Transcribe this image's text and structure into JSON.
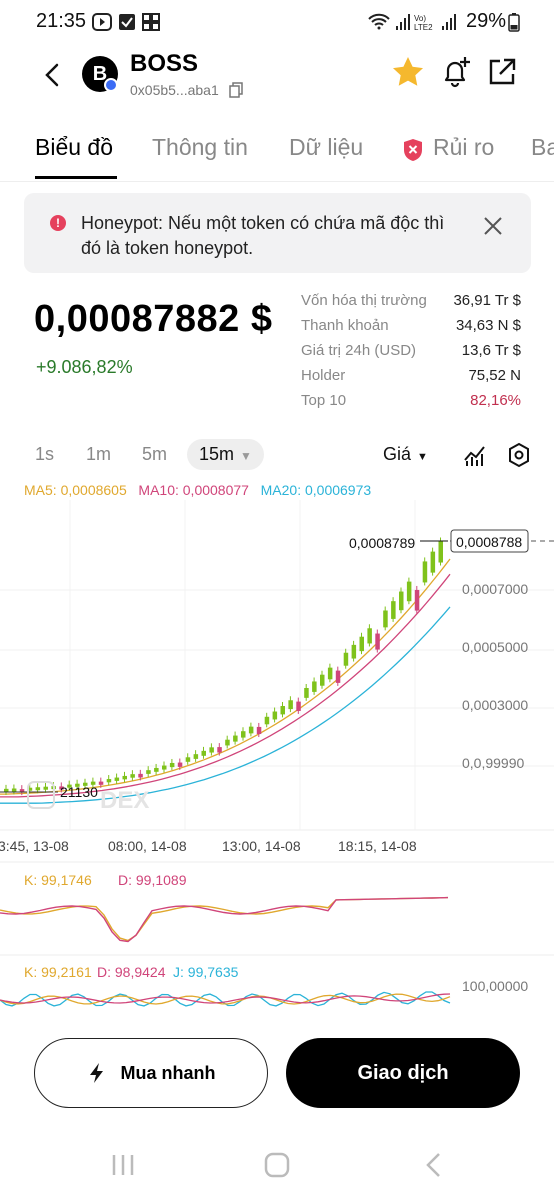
{
  "status_bar": {
    "time": "21:35",
    "battery": "29%"
  },
  "header": {
    "token_logo_letter": "B",
    "token_name": "BOSS",
    "token_address": "0x05b5...aba1"
  },
  "tabs": [
    {
      "label": "Biểu đồ",
      "active": true
    },
    {
      "label": "Thông tin",
      "active": false
    },
    {
      "label": "Dữ liệu",
      "active": false
    },
    {
      "label": "Rủi ro",
      "active": false
    },
    {
      "label": "Ba",
      "active": false
    }
  ],
  "alert": {
    "text": "Honeypot: Nếu một token có chứa mã độc thì đó là token honeypot."
  },
  "price": {
    "value": "0,00087882 $",
    "change": "+9.086,82%"
  },
  "stats": [
    {
      "label": "Vốn hóa thị trường",
      "value": "36,91 Tr $"
    },
    {
      "label": "Thanh khoản",
      "value": "34,63 N $"
    },
    {
      "label": "Giá trị 24h (USD)",
      "value": "13,6 Tr $"
    },
    {
      "label": "Holder",
      "value": "75,52 N"
    },
    {
      "label": "Top 10",
      "value": "82,16%"
    }
  ],
  "intervals": [
    "1s",
    "1m",
    "5m",
    "15m"
  ],
  "active_interval": "15m",
  "price_selector": "Giá",
  "ma_legend": {
    "ma5": "MA5: 0,0008605",
    "ma10": "MA10: 0,0008077",
    "ma20": "MA20: 0,0006973"
  },
  "chart_data": {
    "type": "candlestick",
    "y_ticks": [
      "0,0007000",
      "0,0005000",
      "0,0003000",
      "0,0,99990"
    ],
    "x_ticks": [
      "3:45, 13-08",
      "08:00, 14-08",
      "13:00, 14-08",
      "18:15, 14-08"
    ],
    "high_label": "0,0008789",
    "current_label": "0,0008788",
    "low_label": "21130",
    "watermark": "DEX",
    "series": [
      {
        "name": "MA5",
        "color": "#e0a82e"
      },
      {
        "name": "MA10",
        "color": "#d0457a"
      },
      {
        "name": "MA20",
        "color": "#2bb3d8"
      }
    ]
  },
  "kd_indicator": {
    "k": "K: 99,1746",
    "d": "D: 99,1089"
  },
  "kdj_indicator": {
    "k": "K: 99,2161",
    "d": "D: 98,9424",
    "j": "J: 99,7635",
    "level": "100,00000"
  },
  "buttons": {
    "quick_buy": "Mua nhanh",
    "trade": "Giao dịch"
  },
  "colors": {
    "up": "#7fc21b",
    "alert_red": "#e5415d",
    "top10_red": "#c1304f",
    "change_green": "#2a7a2a"
  }
}
